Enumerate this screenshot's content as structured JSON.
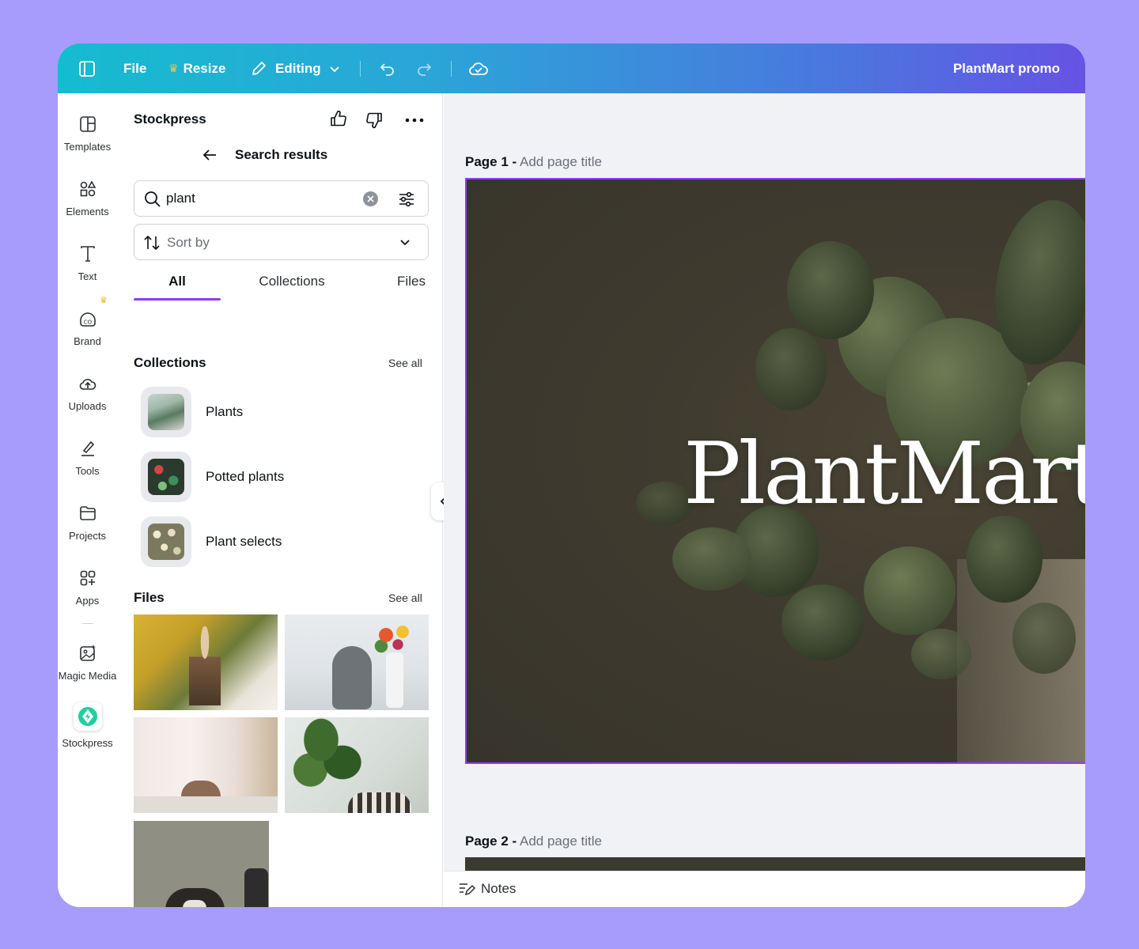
{
  "app": {
    "document_title": "PlantMart promo"
  },
  "topbar": {
    "file_label": "File",
    "resize_label": "Resize",
    "editing_label": "Editing"
  },
  "rail": {
    "items": [
      {
        "label": "Templates",
        "icon": "templates-icon"
      },
      {
        "label": "Elements",
        "icon": "elements-icon"
      },
      {
        "label": "Text",
        "icon": "text-icon"
      },
      {
        "label": "Brand",
        "icon": "brand-icon"
      },
      {
        "label": "Uploads",
        "icon": "uploads-icon"
      },
      {
        "label": "Tools",
        "icon": "tools-icon"
      },
      {
        "label": "Projects",
        "icon": "projects-icon"
      },
      {
        "label": "Apps",
        "icon": "apps-icon"
      },
      {
        "label": "Magic Media",
        "icon": "magic-media-icon"
      },
      {
        "label": "Stockpress",
        "icon": "stockpress-icon"
      }
    ]
  },
  "panel": {
    "app_name": "Stockpress",
    "back_title": "Search results",
    "search": {
      "value": "plant"
    },
    "sort": {
      "placeholder": "Sort by"
    },
    "tabs": [
      {
        "label": "All",
        "active": true
      },
      {
        "label": "Collections",
        "active": false
      },
      {
        "label": "Files",
        "active": false
      }
    ],
    "collections": {
      "title": "Collections",
      "see_all": "See all",
      "items": [
        {
          "label": "Plants"
        },
        {
          "label": "Potted plants"
        },
        {
          "label": "Plant selects"
        }
      ]
    },
    "files": {
      "title": "Files",
      "see_all": "See all",
      "count": 5
    }
  },
  "canvas": {
    "page1": {
      "label": "Page 1 -",
      "placeholder": "Add page title",
      "heading": "PlantMart"
    },
    "page2": {
      "label": "Page 2 -",
      "placeholder": "Add page title"
    },
    "notes_label": "Notes"
  },
  "colors": {
    "accent": "#8b3dff",
    "topbar_start": "#15bccf",
    "topbar_end": "#6653e4",
    "background": "#a79bfb"
  }
}
